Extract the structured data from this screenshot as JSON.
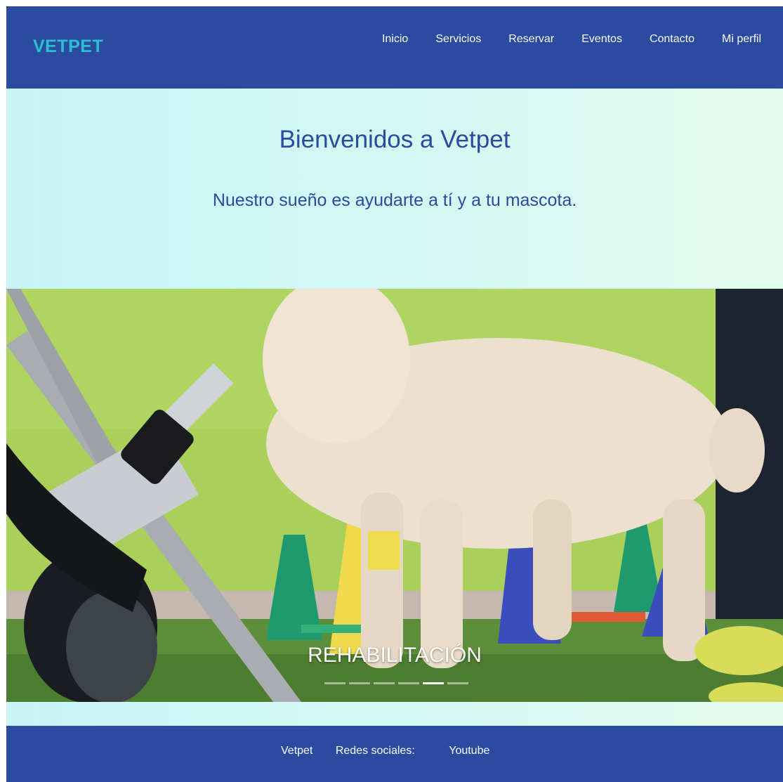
{
  "header": {
    "logo": "VETPET",
    "nav": [
      {
        "label": "Inicio"
      },
      {
        "label": "Servicios"
      },
      {
        "label": "Reservar"
      },
      {
        "label": "Eventos"
      },
      {
        "label": "Contacto"
      },
      {
        "label": "Mi perfil"
      }
    ]
  },
  "hero": {
    "title": "Bienvenidos a Vetpet",
    "subtitle": "Nuestro sueño es ayudarte a tí y a tu mascota."
  },
  "carousel": {
    "caption": "REHABILITACIÓN",
    "slide_count": 6,
    "active_index": 4
  },
  "footer": {
    "brand": "Vetpet",
    "social_label": "Redes sociales:",
    "youtube": "Youtube"
  },
  "colors": {
    "navbar": "#2a4ba0",
    "logo": "#2bc0cf",
    "heading": "#2a4ba0"
  }
}
